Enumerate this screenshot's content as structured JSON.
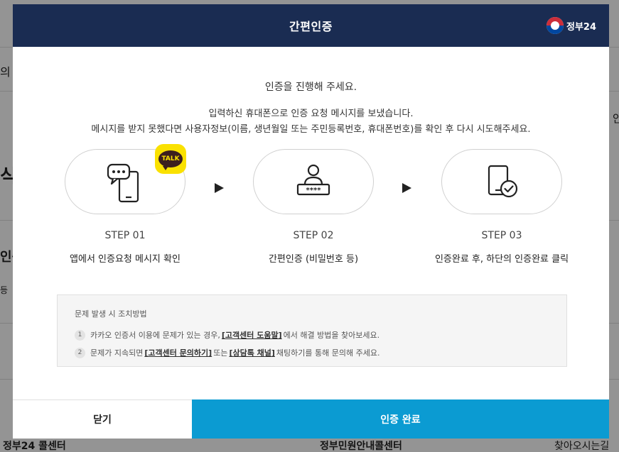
{
  "background": {
    "left_texts": [
      "의",
      "식",
      "인증",
      "등"
    ],
    "right_texts": [
      "안"
    ],
    "footer": {
      "left": "정부24 콜센터",
      "center": "정부민원안내콜센터",
      "right": "찾아오시는길"
    }
  },
  "modal": {
    "title": "간편인증",
    "gov_logo_text": "정부24",
    "lead": "인증을 진행해 주세요.",
    "desc_line1": "입력하신 휴대폰으로 인증 요청 메시지를 보냈습니다.",
    "desc_line2": "메시지를 받지 못했다면 사용자정보(이름, 생년월일 또는 주민등록번호, 휴대폰번호)를 확인 후 다시 시도해주세요.",
    "steps": [
      {
        "label": "STEP 01",
        "desc": "앱에서 인증요청 메시지 확인",
        "icon": "phone-chat-icon",
        "badge": "TALK"
      },
      {
        "label": "STEP 02",
        "desc": "간편인증 (비밀번호 등)",
        "icon": "user-password-icon"
      },
      {
        "label": "STEP 03",
        "desc": "인증완료 후, 하단의 인증완료 클릭",
        "icon": "phone-check-icon"
      }
    ],
    "help": {
      "title": "문제 발생 시 조치방법",
      "item1": {
        "num": "1",
        "pre": "카카오 인증서 이용에 문제가 있는 경우,",
        "link": "[고객센터 도움말]",
        "post": "에서 해결 방법을 찾아보세요."
      },
      "item2": {
        "num": "2",
        "pre": "문제가 지속되면",
        "link1": "[고객센터 문의하기]",
        "mid": "또는",
        "link2": "[상담톡 채널]",
        "post": "채팅하기를 통해 문의해 주세요."
      }
    },
    "buttons": {
      "close": "닫기",
      "confirm": "인증 완료"
    }
  },
  "colors": {
    "header": "#1a2c52",
    "confirm": "#0b9bd2",
    "kakao": "#fae100"
  }
}
